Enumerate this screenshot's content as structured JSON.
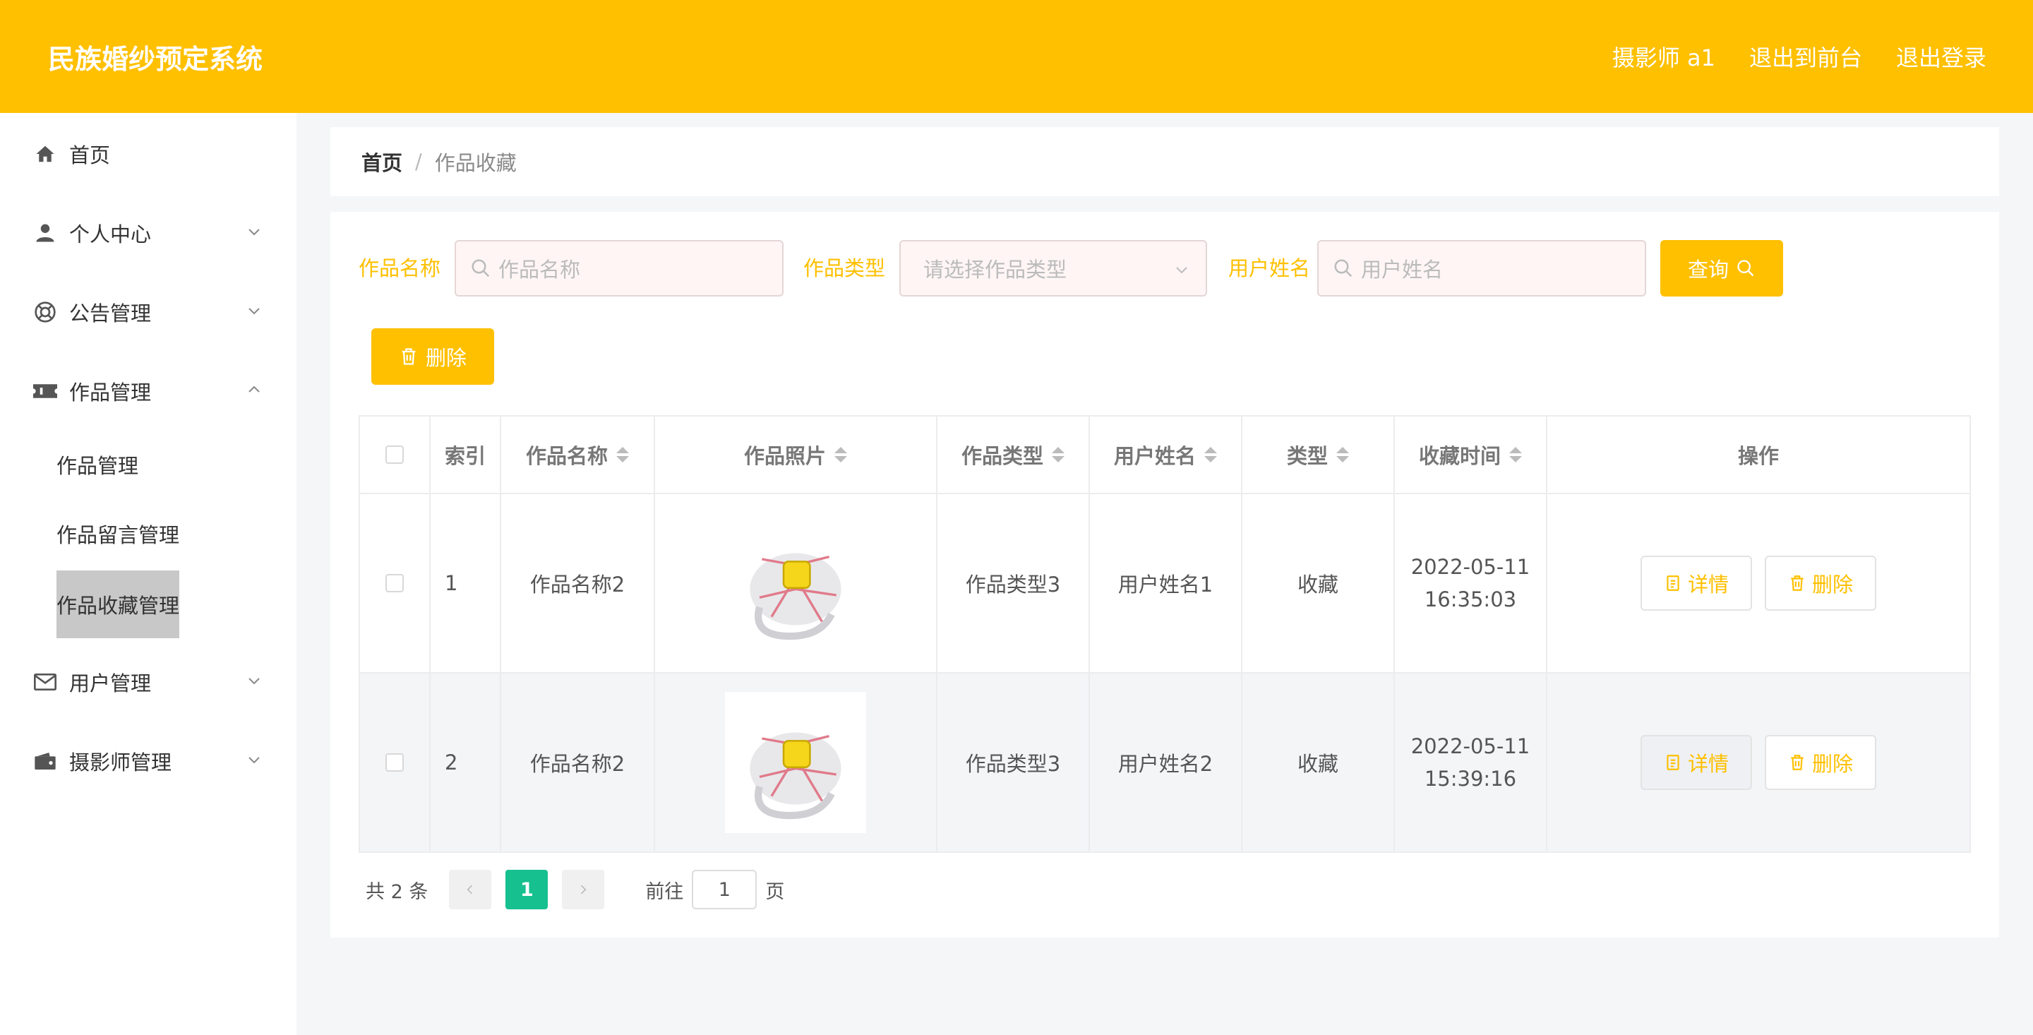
{
  "header": {
    "title": "民族婚纱预定系统",
    "nav": [
      "摄影师 a1",
      "退出到前台",
      "退出登录"
    ],
    "bg_color": "#ffc000"
  },
  "sidebar": {
    "items": [
      {
        "label": "首页",
        "icon": "home-icon"
      },
      {
        "label": "个人中心",
        "icon": "user-icon"
      },
      {
        "label": "公告管理",
        "icon": "lifebuoy-icon"
      },
      {
        "label": "作品管理",
        "icon": "ticket-icon"
      },
      {
        "label": "用户管理",
        "icon": "mail-icon"
      },
      {
        "label": "摄影师管理",
        "icon": "wallet-icon"
      }
    ],
    "sub_items": [
      "作品管理",
      "作品留言管理",
      "作品收藏管理"
    ]
  },
  "breadcrumb": {
    "home": "首页",
    "separator": "/",
    "current": "作品收藏"
  },
  "search": {
    "name_label": "作品名称",
    "name_placeholder": "作品名称",
    "type_label": "作品类型",
    "type_placeholder": "请选择作品类型",
    "user_label": "用户姓名",
    "user_placeholder": "用户姓名",
    "query_label": "查询"
  },
  "toolbar": {
    "delete_label": "删除"
  },
  "table": {
    "headers": [
      "索引",
      "作品名称",
      "作品照片",
      "作品类型",
      "用户姓名",
      "类型",
      "收藏时间",
      "操作"
    ],
    "rows": [
      {
        "index": "1",
        "name": "作品名称2",
        "type": "作品类型3",
        "user": "用户姓名1",
        "kind": "收藏",
        "date": "2022-05-11",
        "time": "16:35:03"
      },
      {
        "index": "2",
        "name": "作品名称2",
        "type": "作品类型3",
        "user": "用户姓名2",
        "kind": "收藏",
        "date": "2022-05-11",
        "time": "15:39:16"
      }
    ],
    "detail_label": "详情",
    "delete_label": "删除"
  },
  "pagination": {
    "total_text": "共 2 条",
    "current_page": "1",
    "goto_label": "前往",
    "goto_value": "1",
    "page_suffix": "页"
  }
}
